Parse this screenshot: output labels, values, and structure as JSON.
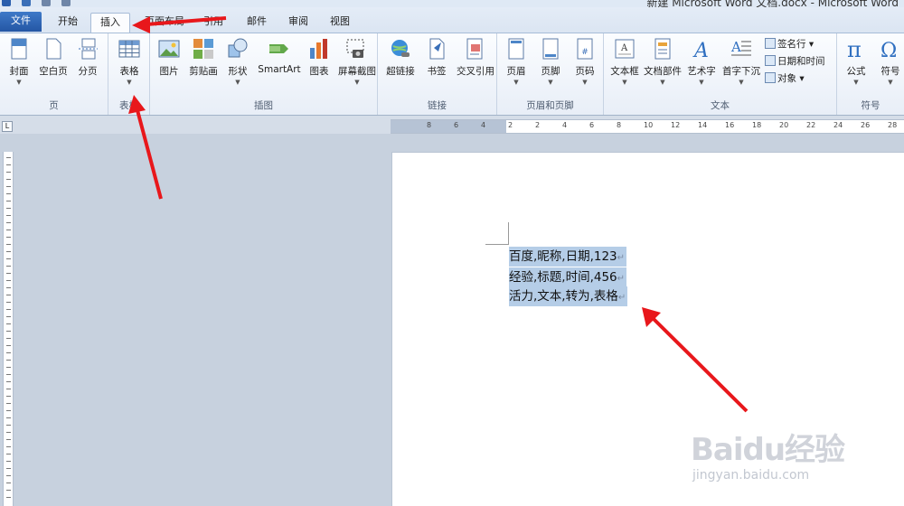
{
  "window": {
    "title": "新建 Microsoft Word 文档.docx - Microsoft Word"
  },
  "tabs": [
    {
      "label": "文件"
    },
    {
      "label": "开始"
    },
    {
      "label": "插入"
    },
    {
      "label": "页面布局"
    },
    {
      "label": "引用"
    },
    {
      "label": "邮件"
    },
    {
      "label": "审阅"
    },
    {
      "label": "视图"
    }
  ],
  "ribbon": {
    "groups": {
      "pages": {
        "label": "页",
        "items": [
          "封面",
          "空白页",
          "分页"
        ]
      },
      "tables": {
        "label": "表格",
        "items": [
          "表格"
        ]
      },
      "illustrations": {
        "label": "插图",
        "items": [
          "图片",
          "剪贴画",
          "形状",
          "SmartArt",
          "图表",
          "屏幕截图"
        ]
      },
      "links": {
        "label": "链接",
        "items": [
          "超链接",
          "书签",
          "交叉引用"
        ]
      },
      "header_footer": {
        "label": "页眉和页脚",
        "items": [
          "页眉",
          "页脚",
          "页码"
        ]
      },
      "text": {
        "label": "文本",
        "items": [
          "文本框",
          "文档部件",
          "艺术字",
          "首字下沉"
        ],
        "small": [
          "签名行",
          "日期和时间",
          "对象"
        ]
      },
      "symbols": {
        "label": "符号",
        "items": [
          "公式",
          "符号"
        ]
      }
    }
  },
  "ruler": {
    "ticks": [
      "8",
      "6",
      "4",
      "2",
      "2",
      "4",
      "6",
      "8",
      "10",
      "12",
      "14",
      "16",
      "18",
      "20",
      "22",
      "24",
      "26",
      "28"
    ]
  },
  "document": {
    "lines": [
      "百度,昵称,日期,123",
      "经验,标题,时间,456",
      "活力,文本,转为,表格"
    ],
    "paragraph_mark": "↵"
  },
  "watermark": {
    "brand": "Baidu经验",
    "url": "jingyan.baidu.com"
  },
  "colors": {
    "arrow": "#e8171b",
    "selection": "#b5cde7",
    "file_tab": "#2b5fad"
  }
}
